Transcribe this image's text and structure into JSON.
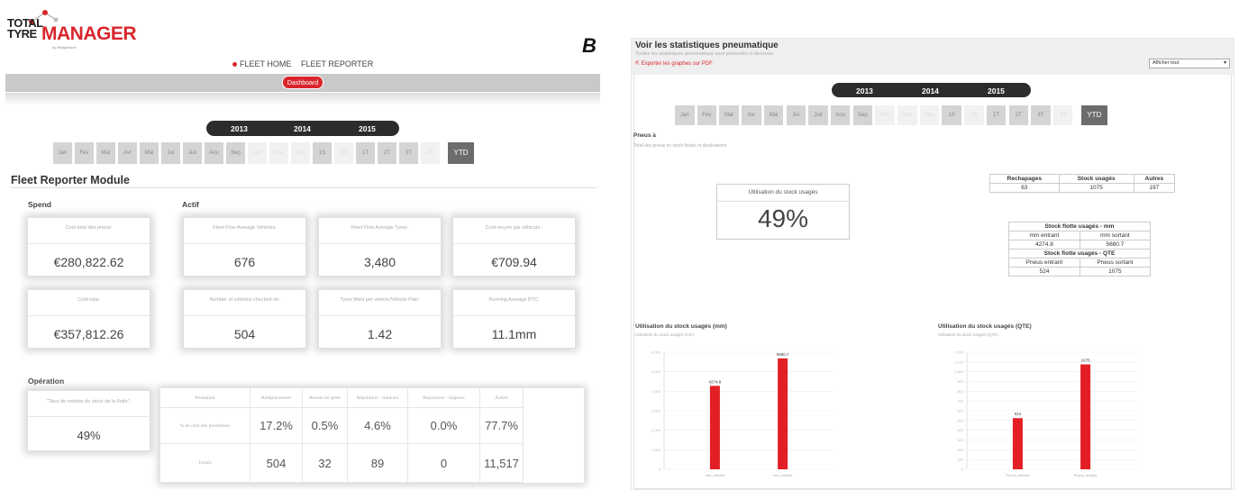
{
  "colors": {
    "brand_red": "#d9262c",
    "dark_bar": "#2c2c2c",
    "month_active": "#d4d4d4",
    "month_inactive": "#f1f1f1",
    "ytd": "#6c6c6c"
  },
  "left": {
    "logo": {
      "total": "TOTAL",
      "tyre": "TYRE",
      "manager": "MANAGER",
      "sub": "by Bridgestone"
    },
    "brand_mark": "B",
    "nav": {
      "fleet_home": "FLEET HOME",
      "fleet_reporter": "FLEET REPORTER"
    },
    "dashboard_button": "Dashboard",
    "years": [
      "2013",
      "2014",
      "2015"
    ],
    "months": [
      {
        "label": "Jan",
        "state": "active"
      },
      {
        "label": "Fev",
        "state": "active"
      },
      {
        "label": "Mar",
        "state": "active"
      },
      {
        "label": "Avr",
        "state": "active"
      },
      {
        "label": "Mai",
        "state": "active"
      },
      {
        "label": "Jui",
        "state": "active"
      },
      {
        "label": "Juil",
        "state": "active"
      },
      {
        "label": "Aou",
        "state": "active"
      },
      {
        "label": "Sep",
        "state": "active"
      },
      {
        "label": "Oct",
        "state": "off"
      },
      {
        "label": "Nov",
        "state": "off"
      },
      {
        "label": "Dec",
        "state": "off"
      },
      {
        "label": "1S",
        "state": "active"
      },
      {
        "label": "2S",
        "state": "off"
      },
      {
        "label": "1T",
        "state": "active"
      },
      {
        "label": "2T",
        "state": "active"
      },
      {
        "label": "3T",
        "state": "active"
      },
      {
        "label": "4T",
        "state": "off"
      },
      {
        "label": "YTD",
        "state": "dark"
      }
    ],
    "module_title": "Fleet Reporter Module",
    "spend_label": "Spend",
    "actif_label": "Actif",
    "operation_label": "Opération",
    "cards": {
      "cout_total_pneus": {
        "label": "Coût total des pneus:",
        "value": "€280,822.62"
      },
      "cout_total": {
        "label": "Coût total:",
        "value": "€357,812.26"
      },
      "fleet_vehicles": {
        "label": "Fleet Flow Average Vehicles:",
        "value": "676"
      },
      "fleet_tyres": {
        "label": "Fleet Flow Average Tyres:",
        "value": "3,480"
      },
      "cout_moyen": {
        "label": "Coût moyen par véhicule :",
        "value": "€709.94"
      },
      "vehicles_checked": {
        "label": "Number of vehicles checked on:",
        "value": "504"
      },
      "tyres_fitted": {
        "label": "Tyres fitted per vehicle/Vehicle Plan:",
        "value": "1.42"
      },
      "running_btc": {
        "label": "Running Average BTC:",
        "value": "11.1mm"
      },
      "taux_rotation": {
        "label": "\"Taux de rotation du stock de la flotte\":",
        "value": "49%"
      }
    },
    "operation": {
      "headers": [
        "Prestation",
        "Remplacement",
        "Retour sur piste",
        "Réparation - mineure",
        "Réparation - majeure",
        "Autres"
      ],
      "rows": [
        {
          "label": "% de coût des prestations",
          "values": [
            "17.2%",
            "0.5%",
            "4.6%",
            "0.0%",
            "77.7%"
          ]
        },
        {
          "label": "Unités",
          "values": [
            "504",
            "32",
            "89",
            "0",
            "11,517"
          ]
        }
      ]
    }
  },
  "right": {
    "title": "Voir les statistiques pneumatique",
    "subtitle": "Toutes les statistiques pneumatique sont présentés ci-dessous.",
    "export_link": "Exporter les graphes sur PDF",
    "select_value": "Afficher tout",
    "years": [
      "2013",
      "2014",
      "2015"
    ],
    "months": [
      {
        "label": "Jan",
        "state": "active"
      },
      {
        "label": "Fev",
        "state": "active"
      },
      {
        "label": "Mar",
        "state": "active"
      },
      {
        "label": "Avr",
        "state": "active"
      },
      {
        "label": "Mai",
        "state": "active"
      },
      {
        "label": "Jui",
        "state": "active"
      },
      {
        "label": "Juil",
        "state": "active"
      },
      {
        "label": "Aou",
        "state": "active"
      },
      {
        "label": "Sep",
        "state": "active"
      },
      {
        "label": "Oct",
        "state": "off"
      },
      {
        "label": "Nov",
        "state": "off"
      },
      {
        "label": "Dec",
        "state": "off"
      },
      {
        "label": "1S",
        "state": "active"
      },
      {
        "label": "2S",
        "state": "off"
      },
      {
        "label": "1T",
        "state": "active"
      },
      {
        "label": "2T",
        "state": "active"
      },
      {
        "label": "3T",
        "state": "active"
      },
      {
        "label": "4T",
        "state": "off"
      },
      {
        "label": "YTD",
        "state": "dark"
      }
    ],
    "pneus_title": "Pneus à",
    "pneus_sub": "Total des pneus en stock flottes et destinations",
    "util_box": {
      "label": "Utilisation du stock usagés",
      "value": "49%"
    },
    "summary_table": {
      "headers": [
        "Rechapages",
        "Stock usagés",
        "Autres"
      ],
      "values": [
        "63",
        "1075",
        "197"
      ]
    },
    "stock_table": {
      "mm_title": "Stock flotte usagés - mm",
      "mm_headers": [
        "mm entrant",
        "mm sortant"
      ],
      "mm_values": [
        "4274.8",
        "5680.7"
      ],
      "qte_title": "Stock flotte usagés - QTE",
      "qte_headers": [
        "Pneus entrant",
        "Pneus sortant"
      ],
      "qte_values": [
        "524",
        "1075"
      ]
    }
  },
  "chart_data": [
    {
      "type": "bar",
      "title": "Utilisation du stock usagés (mm)",
      "subtitle": "Utilisation du stock usagés (mm)",
      "categories": [
        "mm_entrant",
        "mm_sortant"
      ],
      "values": [
        4274.8,
        5680.7
      ],
      "data_labels": [
        "4274.8",
        "5680.7"
      ],
      "y_ticks": [
        "0",
        "1,000",
        "2,000",
        "3,000",
        "4,000",
        "5,000",
        "6,000"
      ],
      "ylim": [
        0,
        6000
      ],
      "bar_color": "#e31e24",
      "grid": true
    },
    {
      "type": "bar",
      "title": "Utilisation du stock usagés (QTE)",
      "subtitle": "Utilisation du stock usagés (QTE)",
      "categories": [
        "Pneus_entrant",
        "Pneus_sortant"
      ],
      "values": [
        524,
        1075
      ],
      "data_labels": [
        "524",
        "1075"
      ],
      "y_ticks": [
        "0",
        "100",
        "200",
        "300",
        "400",
        "500",
        "600",
        "700",
        "800",
        "900",
        "1,000",
        "1,100",
        "1,200"
      ],
      "ylim": [
        0,
        1200
      ],
      "bar_color": "#e31e24",
      "grid": true
    }
  ]
}
